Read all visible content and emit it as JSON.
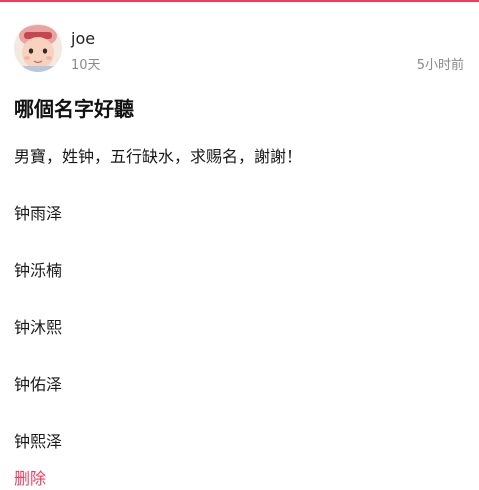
{
  "theme": {
    "accent": "#e8405f",
    "meta_text": "#8a8a8a"
  },
  "author": {
    "name": "joe",
    "baby_age": "10天",
    "avatar_icon": "baby-photo-avatar"
  },
  "post": {
    "time": "5小时前",
    "title": "哪個名字好聽",
    "lines": [
      "男寶，姓钟，五行缺水，求赐名，謝謝！",
      "钟雨泽",
      "钟泺楠",
      "钟沐熙",
      "钟佑泽",
      "钟熙泽"
    ],
    "delete_label": "删除"
  }
}
